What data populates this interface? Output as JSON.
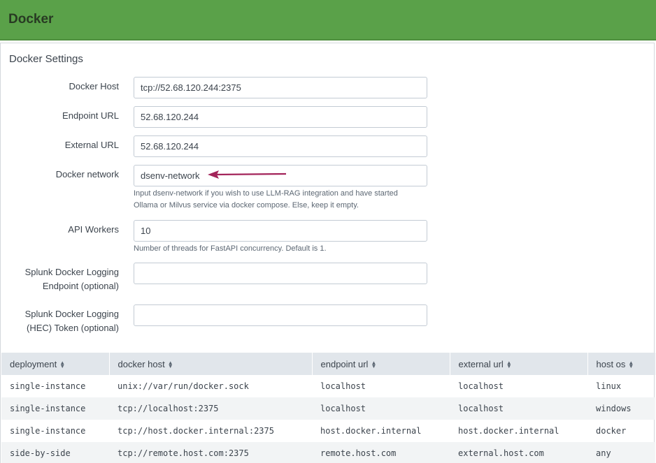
{
  "header": {
    "title": "Docker"
  },
  "settings": {
    "title": "Docker Settings",
    "fields": {
      "docker_host": {
        "label": "Docker Host",
        "value": "tcp://52.68.120.244:2375"
      },
      "endpoint_url": {
        "label": "Endpoint URL",
        "value": "52.68.120.244"
      },
      "external_url": {
        "label": "External URL",
        "value": "52.68.120.244"
      },
      "docker_network": {
        "label": "Docker network",
        "value": "dsenv-network",
        "help_line1": "Input dsenv-network if you wish to use LLM-RAG integration and have started",
        "help_line2": "Ollama or Milvus service via docker compose. Else, keep it empty."
      },
      "api_workers": {
        "label": "API Workers",
        "value": "10",
        "help": "Number of threads for FastAPI concurrency. Default is 1."
      },
      "splunk_endpoint": {
        "label_line1": "Splunk Docker Logging",
        "label_line2": "Endpoint (optional)",
        "value": ""
      },
      "splunk_token": {
        "label_line1": "Splunk Docker Logging",
        "label_line2": "(HEC) Token (optional)",
        "value": ""
      }
    }
  },
  "annotation": {
    "arrow_color": "#a3245a"
  },
  "table": {
    "columns": [
      "deployment",
      "docker host",
      "endpoint url",
      "external url",
      "host os"
    ],
    "rows": [
      [
        "single-instance",
        "unix://var/run/docker.sock",
        "localhost",
        "localhost",
        "linux"
      ],
      [
        "single-instance",
        "tcp://localhost:2375",
        "localhost",
        "localhost",
        "windows"
      ],
      [
        "single-instance",
        "tcp://host.docker.internal:2375",
        "host.docker.internal",
        "host.docker.internal",
        "docker"
      ],
      [
        "side-by-side",
        "tcp://remote.host.com:2375",
        "remote.host.com",
        "external.host.com",
        "any"
      ]
    ]
  }
}
